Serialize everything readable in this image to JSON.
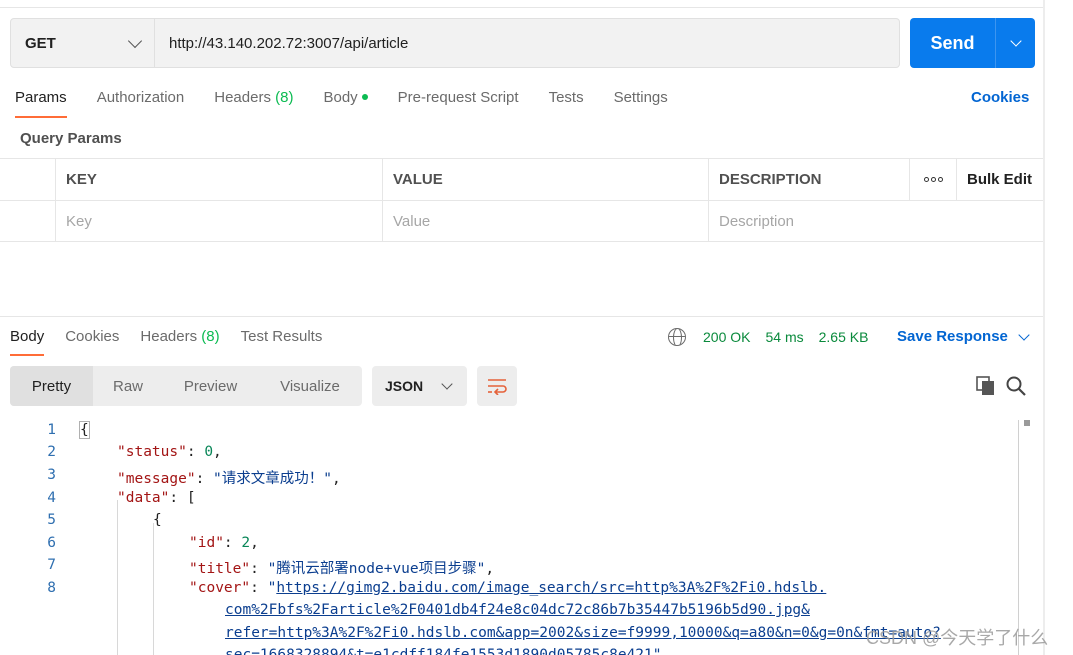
{
  "request": {
    "method": "GET",
    "url": "http://43.140.202.72:3007/api/article",
    "send_label": "Send"
  },
  "request_tabs": [
    {
      "label": "Params",
      "active": true
    },
    {
      "label": "Authorization"
    },
    {
      "label": "Headers",
      "count": "(8)"
    },
    {
      "label": "Body",
      "indicator": "green-dot"
    },
    {
      "label": "Pre-request Script"
    },
    {
      "label": "Tests"
    },
    {
      "label": "Settings"
    }
  ],
  "cookies_link": "Cookies",
  "query_params": {
    "title": "Query Params",
    "columns": [
      "KEY",
      "VALUE",
      "DESCRIPTION"
    ],
    "bulk_edit": "Bulk Edit",
    "placeholders": {
      "key": "Key",
      "value": "Value",
      "description": "Description"
    }
  },
  "response_tabs": [
    {
      "label": "Body",
      "active": true
    },
    {
      "label": "Cookies"
    },
    {
      "label": "Headers",
      "count": "(8)"
    },
    {
      "label": "Test Results"
    }
  ],
  "response_meta": {
    "icon": "globe-icon",
    "status": "200 OK",
    "time": "54 ms",
    "size": "2.65 KB",
    "save_label": "Save Response"
  },
  "view_modes": [
    "Pretty",
    "Raw",
    "Preview",
    "Visualize"
  ],
  "active_view": "Pretty",
  "format": "JSON",
  "code": {
    "line_numbers": [
      "1",
      "2",
      "3",
      "4",
      "5",
      "6",
      "7",
      "8"
    ],
    "l1": "{",
    "l2_key": "\"status\"",
    "l2_val": "0",
    "l3_key": "\"message\"",
    "l3_val": "\"请求文章成功！\"",
    "l4_key": "\"data\"",
    "l4_rest": ": [",
    "l5": "{",
    "l6_key": "\"id\"",
    "l6_val": "2",
    "l7_key": "\"title\"",
    "l7_val": "\"腾讯云部署node+vue项目步骤\"",
    "l8_key": "\"cover\"",
    "l8_quote": "\"",
    "cover_lines": [
      "https://gimg2.baidu.com/image_search/src=http%3A%2F%2Fi0.hdslb.",
      "com%2Fbfs%2Farticle%2F0401db4f24e8c04dc72c86b7b35447b5196b5d90.jpg&",
      "refer=http%3A%2F%2Fi0.hdslb.com&app=2002&size=f9999,10000&q=a80&n=0&g=0n&fmt=auto?",
      "sec=1668328894&t=e1cdff184fe1553d1890d05785c8e421\","
    ]
  },
  "watermark": "CSDN @今天学了什么",
  "colors": {
    "accent": "#ff6c37",
    "primary": "#097bed",
    "link": "#0265d2",
    "success": "#0cbb52"
  }
}
